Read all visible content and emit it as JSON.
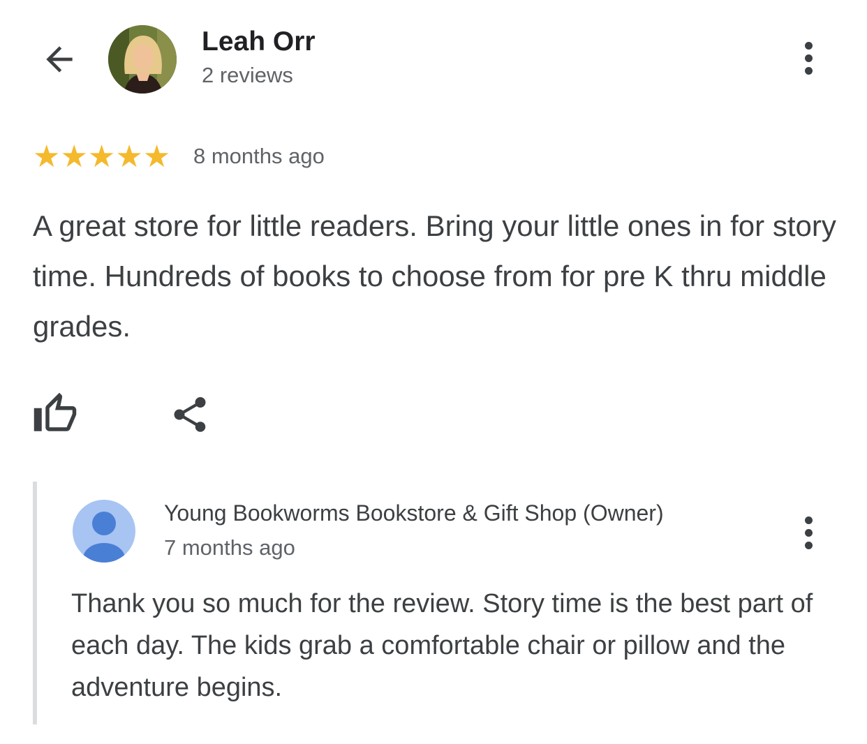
{
  "header": {
    "back_icon": "arrow-back-icon",
    "reviewer_name": "Leah Orr",
    "reviewer_reviews": "2 reviews",
    "more_icon": "more-vert-icon"
  },
  "review": {
    "rating": 5,
    "rating_max": 5,
    "star_color": "#f4b92c",
    "time": "8 months ago",
    "text": "A great store for little readers. Bring your little ones in for story time. Hundreds of books to choose from for pre K thru middle grades."
  },
  "actions": {
    "like_icon": "thumb-up-icon",
    "share_icon": "share-icon"
  },
  "reply": {
    "owner_name": "Young Bookworms Bookstore & Gift Shop (Owner)",
    "time": "7 months ago",
    "text": "Thank you so much for the review. Story time is the best part of each day. The kids grab a comfortable chair or pillow and the adventure begins.",
    "avatar_icon": "person-icon",
    "avatar_bg": "#a7c4f2",
    "avatar_fg": "#4a7fd6"
  }
}
